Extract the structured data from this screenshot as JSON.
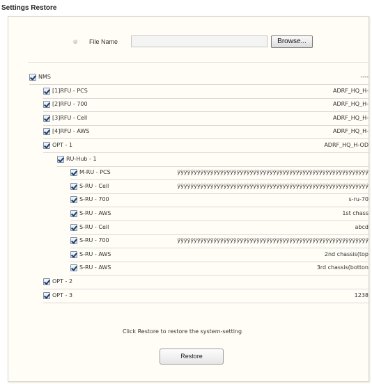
{
  "page": {
    "title": "Settings Restore"
  },
  "file": {
    "label": "File Name",
    "value": "",
    "browse_label": "Browse..."
  },
  "tree": [
    {
      "label": "NMS",
      "value": "----",
      "checked": true,
      "level": 0
    },
    {
      "label": "[1]RFU - PCS",
      "value": "ADRF_HQ_H-",
      "checked": true,
      "level": 1
    },
    {
      "label": "[2]RFU - 700",
      "value": "ADRF_HQ_H-",
      "checked": true,
      "level": 1
    },
    {
      "label": "[3]RFU - Cell",
      "value": "ADRF_HQ_H-",
      "checked": true,
      "level": 1
    },
    {
      "label": "[4]RFU - AWS",
      "value": "ADRF_HQ_H-",
      "checked": true,
      "level": 1
    },
    {
      "label": "OPT - 1",
      "value": "ADRF_HQ_H-OD",
      "checked": true,
      "level": 1
    },
    {
      "label": "RU-Hub - 1",
      "value": "",
      "checked": true,
      "level": 2
    },
    {
      "label": "M-RU - PCS",
      "value": "ÿÿÿÿÿÿÿÿÿÿÿÿÿÿÿÿÿÿÿÿÿÿÿÿÿÿÿÿÿÿÿÿÿÿÿÿÿÿÿÿÿÿÿÿÿÿÿÿÿÿÿÿÿÿÿÿÿÿ",
      "checked": true,
      "level": 3
    },
    {
      "label": "S-RU - Cell",
      "value": "ÿÿÿÿÿÿÿÿÿÿÿÿÿÿÿÿÿÿÿÿÿÿÿÿÿÿÿÿÿÿÿÿÿÿÿÿÿÿÿÿÿÿÿÿÿÿÿÿÿÿÿÿÿÿÿÿÿÿ",
      "checked": true,
      "level": 3
    },
    {
      "label": "S-RU - 700",
      "value": "s-ru-70",
      "checked": true,
      "level": 3
    },
    {
      "label": "S-RU - AWS",
      "value": "1st chass",
      "checked": true,
      "level": 3
    },
    {
      "label": "S-RU - Cell",
      "value": "abcd",
      "checked": true,
      "level": 3
    },
    {
      "label": "S-RU - 700",
      "value": "ÿÿÿÿÿÿÿÿÿÿÿÿÿÿÿÿÿÿÿÿÿÿÿÿÿÿÿÿÿÿÿÿÿÿÿÿÿÿÿÿÿÿÿÿÿÿÿÿÿÿÿÿÿÿÿÿÿÿ",
      "checked": true,
      "level": 3
    },
    {
      "label": "S-RU - AWS",
      "value": "2nd chassis(top",
      "checked": true,
      "level": 3
    },
    {
      "label": "S-RU - AWS",
      "value": "3rd chassis(botton",
      "checked": true,
      "level": 3
    },
    {
      "label": "OPT - 2",
      "value": "",
      "checked": true,
      "level": 1
    },
    {
      "label": "OPT - 3",
      "value": "1238",
      "checked": true,
      "level": 1
    }
  ],
  "footer": {
    "note": "Click Restore to restore the system-setting",
    "restore_label": "Restore"
  }
}
